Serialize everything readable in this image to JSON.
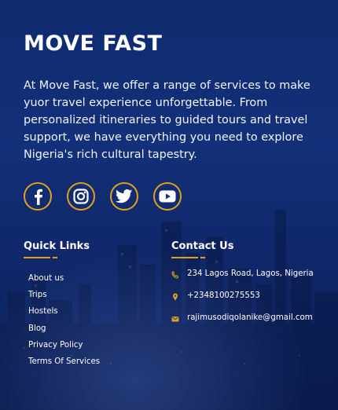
{
  "brand": {
    "name": "MOVE FAST"
  },
  "about": {
    "lines": [
      "At Move Fast, we offer a range of services to make",
      "yuor travel experience unforgettable. From",
      "personalized itineraries to guided tours and travel",
      "support, we have everything you need to explore",
      "Nigeria's rich cultural tapestry."
    ]
  },
  "socials": [
    {
      "icon": "facebook-icon"
    },
    {
      "icon": "instagram-icon"
    },
    {
      "icon": "twitter-icon"
    },
    {
      "icon": "youtube-icon"
    }
  ],
  "quick_links": {
    "title": "Quick Links",
    "items": [
      "About us",
      "Trips",
      "Hostels",
      "Blog",
      "Privacy Policy",
      "Terms Of Services"
    ]
  },
  "contact": {
    "title": "Contact Us",
    "items": [
      {
        "icon": "phone-icon",
        "text": "234 Lagos Road, Lagos, Nigeria"
      },
      {
        "icon": "location-icon",
        "text": "+2348100275553"
      },
      {
        "icon": "mail-icon",
        "text": "rajimusodiqolanike@gmail.com"
      }
    ]
  },
  "colors": {
    "accent": "#e0a21a",
    "background": "#13307a",
    "text": "#ffffff"
  }
}
